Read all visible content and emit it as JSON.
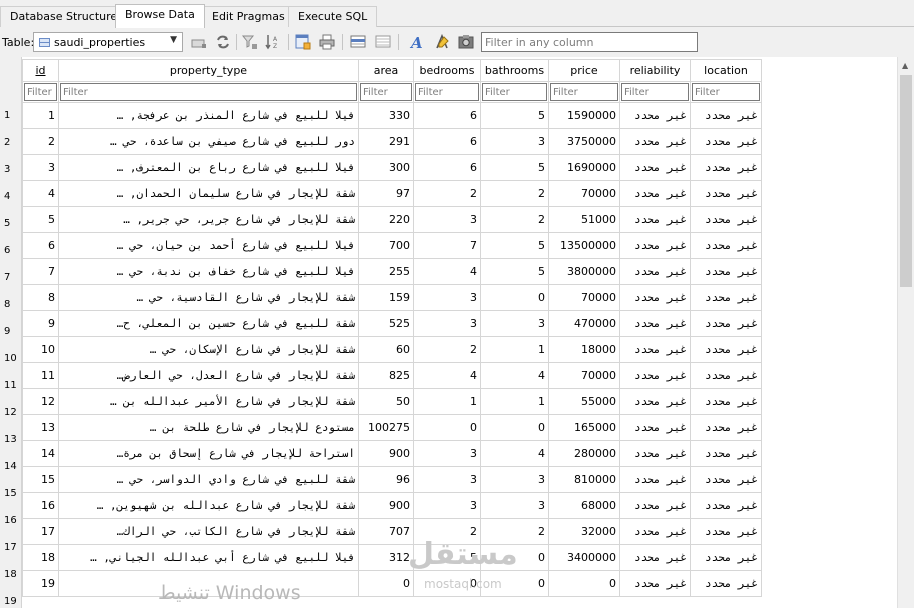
{
  "tabs": [
    {
      "label": "Database Structure",
      "active": false
    },
    {
      "label": "Browse Data",
      "active": true
    },
    {
      "label": "Edit Pragmas",
      "active": false
    },
    {
      "label": "Execute SQL",
      "active": false
    }
  ],
  "toolbar": {
    "table_label": "Table:",
    "table_value": "saudi_properties",
    "filter_all_placeholder": "Filter in any column"
  },
  "grid": {
    "columns": [
      "id",
      "property_type",
      "area",
      "bedrooms",
      "bathrooms",
      "price",
      "reliability",
      "location"
    ],
    "filter_placeholder": "Filter",
    "rows": [
      {
        "n": "1",
        "id": "1",
        "property_type": "فيلا للبيع في شارع المنذر بن عرفجة, …",
        "area": "330",
        "bedrooms": "6",
        "bathrooms": "5",
        "price": "1590000",
        "reliability": "غير محدد",
        "location": "غير محدد"
      },
      {
        "n": "2",
        "id": "2",
        "property_type": "دور للبيع في شارع صيفي بن ساعدة، حي …",
        "area": "291",
        "bedrooms": "6",
        "bathrooms": "3",
        "price": "3750000",
        "reliability": "غير محدد",
        "location": "غير محدد"
      },
      {
        "n": "3",
        "id": "3",
        "property_type": "فيلا للبيع في شارع رباع بن المعترف, …",
        "area": "300",
        "bedrooms": "6",
        "bathrooms": "5",
        "price": "1690000",
        "reliability": "غير محدد",
        "location": "غير محدد"
      },
      {
        "n": "4",
        "id": "4",
        "property_type": "شقة للإيجار في شارع سليمان الحمدان, …",
        "area": "97",
        "bedrooms": "2",
        "bathrooms": "2",
        "price": "70000",
        "reliability": "غير محدد",
        "location": "غير محدد"
      },
      {
        "n": "5",
        "id": "5",
        "property_type": "شقة للإيجار في شارع جرير، حي جرير, …",
        "area": "220",
        "bedrooms": "3",
        "bathrooms": "2",
        "price": "51000",
        "reliability": "غير محدد",
        "location": "غير محدد"
      },
      {
        "n": "6",
        "id": "6",
        "property_type": "فيلا للبيع في شارع أحمد بن حيان، حي …",
        "area": "700",
        "bedrooms": "7",
        "bathrooms": "5",
        "price": "13500000",
        "reliability": "غير محدد",
        "location": "غير محدد"
      },
      {
        "n": "7",
        "id": "7",
        "property_type": "فيلا للبيع في شارع خفاف بن ندبة، حي …",
        "area": "255",
        "bedrooms": "4",
        "bathrooms": "5",
        "price": "3800000",
        "reliability": "غير محدد",
        "location": "غير محدد"
      },
      {
        "n": "8",
        "id": "8",
        "property_type": "شقة للإيجار في شارع القادسية، حي …",
        "area": "159",
        "bedrooms": "3",
        "bathrooms": "0",
        "price": "70000",
        "reliability": "غير محدد",
        "location": "غير محدد"
      },
      {
        "n": "9",
        "id": "9",
        "property_type": "شقة للبيع في شارع حسين بن المعلي، ح…",
        "area": "525",
        "bedrooms": "3",
        "bathrooms": "3",
        "price": "470000",
        "reliability": "غير محدد",
        "location": "غير محدد"
      },
      {
        "n": "10",
        "id": "10",
        "property_type": "شقة للإيجار في شارع الإسكان، حي …",
        "area": "60",
        "bedrooms": "2",
        "bathrooms": "1",
        "price": "18000",
        "reliability": "غير محدد",
        "location": "غير محدد"
      },
      {
        "n": "11",
        "id": "11",
        "property_type": "شقة للإيجار في شارع العدل، حي العارض…",
        "area": "825",
        "bedrooms": "4",
        "bathrooms": "4",
        "price": "70000",
        "reliability": "غير محدد",
        "location": "غير محدد"
      },
      {
        "n": "12",
        "id": "12",
        "property_type": "شقة للإيجار في شارع الأمير عبدالله بن …",
        "area": "50",
        "bedrooms": "1",
        "bathrooms": "1",
        "price": "55000",
        "reliability": "غير محدد",
        "location": "غير محدد"
      },
      {
        "n": "13",
        "id": "13",
        "property_type": "مستودع للإيجار في شارع طلحة بن …",
        "area": "100275",
        "bedrooms": "0",
        "bathrooms": "0",
        "price": "165000",
        "reliability": "غير محدد",
        "location": "غير محدد"
      },
      {
        "n": "14",
        "id": "14",
        "property_type": "استراحة للإيجار في شارع إسحاق بن مرة…",
        "area": "900",
        "bedrooms": "3",
        "bathrooms": "4",
        "price": "280000",
        "reliability": "غير محدد",
        "location": "غير محدد"
      },
      {
        "n": "15",
        "id": "15",
        "property_type": "شقة للبيع في شارع وادي الدواسر، حي …",
        "area": "96",
        "bedrooms": "3",
        "bathrooms": "3",
        "price": "810000",
        "reliability": "غير محدد",
        "location": "غير محدد"
      },
      {
        "n": "16",
        "id": "16",
        "property_type": "شقة للإيجار في شارع عبدالله بن شهيوين, …",
        "area": "900",
        "bedrooms": "3",
        "bathrooms": "3",
        "price": "68000",
        "reliability": "غير محدد",
        "location": "غير محدد"
      },
      {
        "n": "17",
        "id": "17",
        "property_type": "شقة للإيجار في شارع الكاتب، حي الراك…",
        "area": "707",
        "bedrooms": "2",
        "bathrooms": "2",
        "price": "32000",
        "reliability": "غير محدد",
        "location": "غير محدد"
      },
      {
        "n": "18",
        "id": "18",
        "property_type": "فيلا للبيع في شارع أبي عبدالله الجياني, …",
        "area": "312",
        "bedrooms": "5",
        "bathrooms": "0",
        "price": "3400000",
        "reliability": "غير محدد",
        "location": "غير محدد"
      },
      {
        "n": "19",
        "id": "19",
        "property_type": "",
        "area": "0",
        "bedrooms": "0",
        "bathrooms": "0",
        "price": "0",
        "reliability": "غير محدد",
        "location": "غير محدد"
      }
    ]
  },
  "watermark": {
    "text": "تنشيط Windows",
    "logo_text": "مستقل",
    "logo_sub": "mostaql.com"
  },
  "colors": {
    "window_bg": "#f0f0f0",
    "grid_line": "#d6d6d6",
    "input_border": "#7a7a7a"
  }
}
